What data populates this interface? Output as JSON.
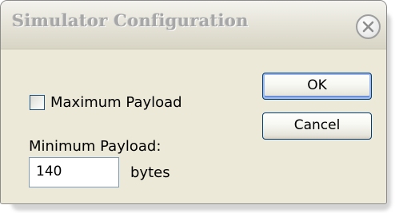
{
  "window": {
    "title": "Simulator Configuration"
  },
  "form": {
    "max_payload_label": "Maximum Payload",
    "max_payload_checked": false,
    "min_payload_label": "Minimum Payload:",
    "min_payload_value": "140",
    "min_payload_unit": "bytes"
  },
  "buttons": {
    "ok_label": "OK",
    "cancel_label": "Cancel"
  },
  "icons": {
    "close": "close-icon"
  },
  "colors": {
    "dialog_bg": "#ece9d8",
    "title_text": "#a7a7a7",
    "checkbox_border": "#1c5180",
    "button_border": "#003c74",
    "input_border": "#7f9db9"
  }
}
